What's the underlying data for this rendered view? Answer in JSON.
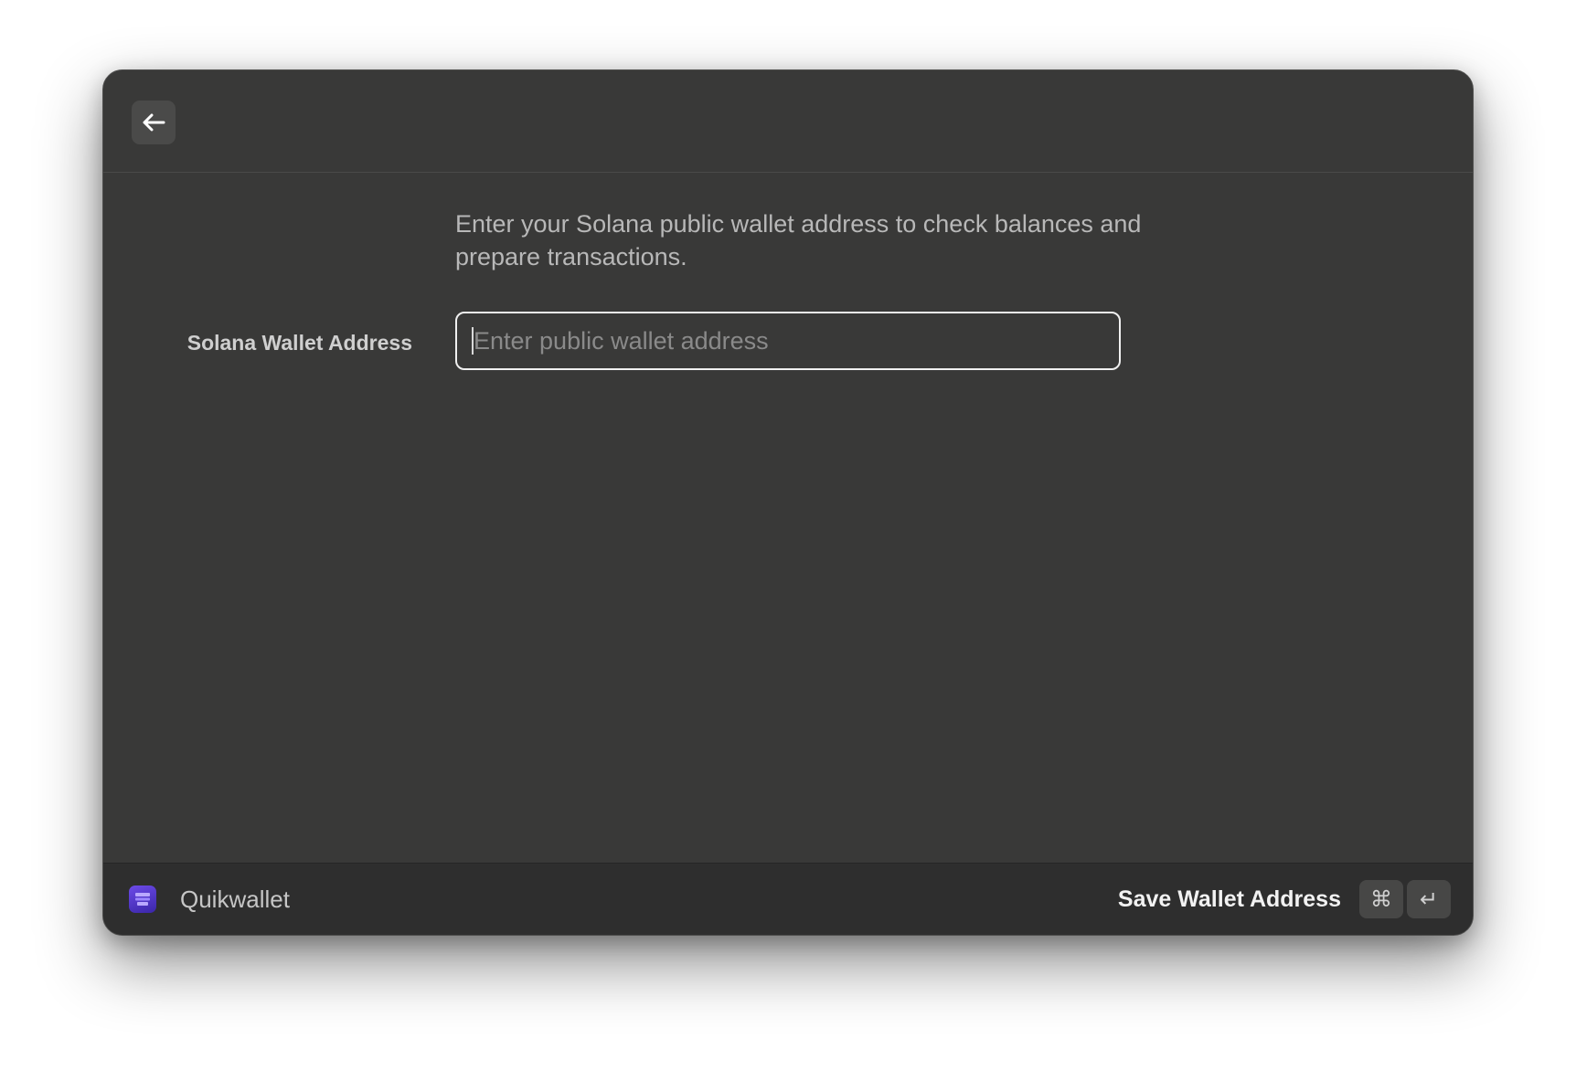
{
  "header": {
    "back_icon": "arrow-left-icon"
  },
  "form": {
    "description": "Enter your Solana public wallet address to check balances and prepare transactions.",
    "field_label": "Solana Wallet Address",
    "field_placeholder": "Enter public wallet address",
    "field_value": ""
  },
  "footer": {
    "app_icon": "quikwallet-app-icon",
    "app_name": "Quikwallet",
    "action_label": "Save Wallet Address",
    "shortcut_cmd": "⌘",
    "shortcut_enter": "↵"
  },
  "colors": {
    "window_bg": "#393938",
    "footer_bg": "#2e2e2e",
    "input_border": "#f0f0f0",
    "app_icon_accent": "#5a3ad6"
  }
}
